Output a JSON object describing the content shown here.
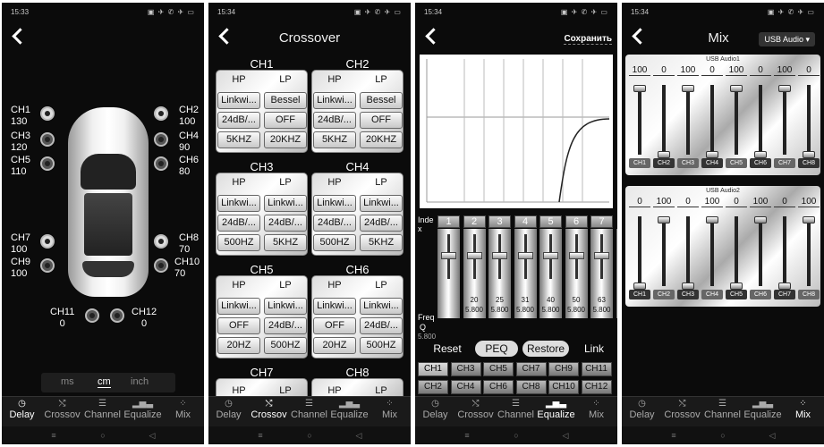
{
  "tabs": [
    {
      "icon": "clock",
      "label": "Delay"
    },
    {
      "icon": "shuffle",
      "label": "Crossov"
    },
    {
      "icon": "sliders",
      "label": "Channel"
    },
    {
      "icon": "bars",
      "label": "Equalize"
    },
    {
      "icon": "grid",
      "label": "Mix"
    }
  ],
  "nav": {
    "menu": "≡",
    "home": "○",
    "back": "◁"
  },
  "screen1": {
    "time": "15:33",
    "status_icons": "▣ ✈ ✆ ✈ ▭",
    "channels": [
      {
        "name": "CH1",
        "value": "130"
      },
      {
        "name": "CH2",
        "value": "100"
      },
      {
        "name": "CH3",
        "value": "120"
      },
      {
        "name": "CH4",
        "value": "90"
      },
      {
        "name": "CH5",
        "value": "110"
      },
      {
        "name": "CH6",
        "value": "80"
      },
      {
        "name": "CH7",
        "value": "100"
      },
      {
        "name": "CH8",
        "value": "70"
      },
      {
        "name": "CH9",
        "value": "100"
      },
      {
        "name": "CH10",
        "value": "70"
      },
      {
        "name": "CH11",
        "value": "0"
      },
      {
        "name": "CH12",
        "value": "0"
      }
    ],
    "units": {
      "ms": "ms",
      "cm": "cm",
      "inch": "inch",
      "selected": "cm"
    }
  },
  "screen2": {
    "time": "15:34",
    "status_icons": "▣ ✈ ✆ ✈ ▭",
    "title": "Crossover",
    "groups": [
      {
        "name": "CH1",
        "hp": "HP",
        "lp": "LP",
        "hp_type": "Linkwi...",
        "lp_type": "Bessel",
        "hp_slope": "24dB/...",
        "lp_slope": "OFF",
        "hp_freq": "5KHZ",
        "lp_freq": "20KHZ"
      },
      {
        "name": "CH2",
        "hp": "HP",
        "lp": "LP",
        "hp_type": "Linkwi...",
        "lp_type": "Bessel",
        "hp_slope": "24dB/...",
        "lp_slope": "OFF",
        "hp_freq": "5KHZ",
        "lp_freq": "20KHZ"
      },
      {
        "name": "CH3",
        "hp": "HP",
        "lp": "LP",
        "hp_type": "Linkwi...",
        "lp_type": "Linkwi...",
        "hp_slope": "24dB/...",
        "lp_slope": "24dB/...",
        "hp_freq": "500HZ",
        "lp_freq": "5KHZ"
      },
      {
        "name": "CH4",
        "hp": "HP",
        "lp": "LP",
        "hp_type": "Linkwi...",
        "lp_type": "Linkwi...",
        "hp_slope": "24dB/...",
        "lp_slope": "24dB/...",
        "hp_freq": "500HZ",
        "lp_freq": "5KHZ"
      },
      {
        "name": "CH5",
        "hp": "HP",
        "lp": "LP",
        "hp_type": "Linkwi...",
        "lp_type": "Linkwi...",
        "hp_slope": "OFF",
        "lp_slope": "24dB/...",
        "hp_freq": "20HZ",
        "lp_freq": "500HZ"
      },
      {
        "name": "CH6",
        "hp": "HP",
        "lp": "LP",
        "hp_type": "Linkwi...",
        "lp_type": "Linkwi...",
        "hp_slope": "OFF",
        "lp_slope": "24dB/...",
        "hp_freq": "20HZ",
        "lp_freq": "500HZ"
      }
    ],
    "partial_groups": [
      {
        "name": "CH7",
        "hp": "HP",
        "lp": "LP"
      },
      {
        "name": "CH8",
        "hp": "HP",
        "lp": "LP"
      }
    ]
  },
  "screen3": {
    "time": "15:34",
    "status_icons": "▣ ✈ ✆ ✈ ▭",
    "save_label": "Сохранить",
    "index_label": "Inde x",
    "freq_label": "Freq",
    "q_label": "Q",
    "bands": [
      {
        "index": "1",
        "freq": "",
        "q": ""
      },
      {
        "index": "2",
        "freq": "20",
        "q": "5.800"
      },
      {
        "index": "3",
        "freq": "25",
        "q": "5.800"
      },
      {
        "index": "4",
        "freq": "31",
        "q": "5.800"
      },
      {
        "index": "5",
        "freq": "40",
        "q": "5.800"
      },
      {
        "index": "6",
        "freq": "50",
        "q": "5.800"
      },
      {
        "index": "7",
        "freq": "63",
        "q": "5.800"
      },
      {
        "index": "",
        "freq": "80",
        "q": "5.800"
      }
    ],
    "first_q": "5.800",
    "buttons": {
      "reset": "Reset",
      "peq": "PEQ",
      "restore": "Restore",
      "link": "Link"
    },
    "channels": [
      "CH1",
      "CH3",
      "CH5",
      "CH7",
      "CH9",
      "CH11",
      "CH2",
      "CH4",
      "CH6",
      "CH8",
      "CH10",
      "CH12"
    ],
    "selected_channel": "CH1"
  },
  "screen4": {
    "time": "15:34",
    "status_icons": "▣ ✈ ✆ ✈ ▭",
    "title": "Mix",
    "source_select": "USB Audio ▾",
    "panel1": {
      "header": "USB Audio1",
      "values": [
        "100",
        "0",
        "100",
        "0",
        "100",
        "0",
        "100",
        "0"
      ],
      "channels": [
        "CH1",
        "CH2",
        "CH3",
        "CH4",
        "CH5",
        "CH6",
        "CH7",
        "CH8"
      ],
      "levels": [
        1.0,
        0.0,
        1.0,
        0.0,
        1.0,
        0.0,
        1.0,
        0.0
      ]
    },
    "panel2": {
      "header": "USB Audio2",
      "values": [
        "0",
        "100",
        "0",
        "100",
        "0",
        "100",
        "0",
        "100"
      ],
      "channels": [
        "CH1",
        "CH2",
        "CH3",
        "CH4",
        "CH5",
        "CH6",
        "CH7",
        "CH8"
      ],
      "levels": [
        0.0,
        1.0,
        0.0,
        1.0,
        0.0,
        1.0,
        0.0,
        1.0
      ]
    }
  }
}
